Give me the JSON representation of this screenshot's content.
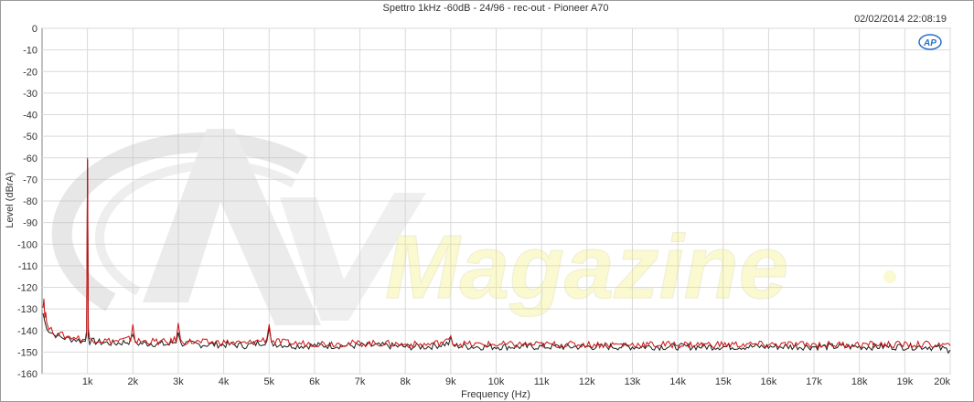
{
  "chart_data": {
    "type": "line",
    "title": "Spettro 1kHz -60dB - 24/96 - rec-out - Pioneer A70",
    "timestamp": "02/02/2014 22:08:19",
    "logo_text": "AP",
    "watermark_text": "Magazine",
    "xlabel": "Frequency (Hz)",
    "ylabel": "Level (dBrA)",
    "xlim": [
      0,
      20000
    ],
    "ylim": [
      -160,
      0
    ],
    "x_ticks": [
      {
        "value": 1000,
        "label": "1k"
      },
      {
        "value": 2000,
        "label": "2k"
      },
      {
        "value": 3000,
        "label": "3k"
      },
      {
        "value": 4000,
        "label": "4k"
      },
      {
        "value": 5000,
        "label": "5k"
      },
      {
        "value": 6000,
        "label": "6k"
      },
      {
        "value": 7000,
        "label": "7k"
      },
      {
        "value": 8000,
        "label": "8k"
      },
      {
        "value": 9000,
        "label": "9k"
      },
      {
        "value": 10000,
        "label": "10k"
      },
      {
        "value": 11000,
        "label": "11k"
      },
      {
        "value": 12000,
        "label": "12k"
      },
      {
        "value": 13000,
        "label": "13k"
      },
      {
        "value": 14000,
        "label": "14k"
      },
      {
        "value": 15000,
        "label": "15k"
      },
      {
        "value": 16000,
        "label": "16k"
      },
      {
        "value": 17000,
        "label": "17k"
      },
      {
        "value": 18000,
        "label": "18k"
      },
      {
        "value": 19000,
        "label": "19k"
      },
      {
        "value": 20000,
        "label": "20k"
      }
    ],
    "y_ticks": [
      {
        "value": 0,
        "label": "0"
      },
      {
        "value": -10,
        "label": "-10"
      },
      {
        "value": -20,
        "label": "-20"
      },
      {
        "value": -30,
        "label": "-30"
      },
      {
        "value": -40,
        "label": "-40"
      },
      {
        "value": -50,
        "label": "-50"
      },
      {
        "value": -60,
        "label": "-60"
      },
      {
        "value": -70,
        "label": "-70"
      },
      {
        "value": -80,
        "label": "-80"
      },
      {
        "value": -90,
        "label": "-90"
      },
      {
        "value": -100,
        "label": "-100"
      },
      {
        "value": -110,
        "label": "-110"
      },
      {
        "value": -120,
        "label": "-120"
      },
      {
        "value": -130,
        "label": "-130"
      },
      {
        "value": -140,
        "label": "-140"
      },
      {
        "value": -150,
        "label": "-150"
      },
      {
        "value": -160,
        "label": "-160"
      }
    ],
    "grid": true,
    "series": [
      {
        "color": "#1a1a1a",
        "x": [
          20,
          60,
          100,
          150,
          200,
          300,
          400,
          500,
          600,
          700,
          800,
          900,
          950,
          980,
          1000,
          1020,
          1050,
          1100,
          1300,
          1600,
          1950,
          2000,
          2050,
          2400,
          2800,
          2950,
          3000,
          3050,
          3500,
          4000,
          4500,
          4950,
          5000,
          5050,
          5500,
          6000,
          6500,
          7000,
          7500,
          8000,
          8500,
          8950,
          9000,
          9050,
          9500,
          10000,
          11000,
          12000,
          13000,
          14000,
          15000,
          16000,
          17000,
          18000,
          19000,
          19500,
          20000
        ],
        "y": [
          -132,
          -136,
          -138,
          -140,
          -141,
          -142,
          -143,
          -143.5,
          -144,
          -144,
          -144.5,
          -145,
          -145,
          -142,
          -61,
          -142,
          -145,
          -145,
          -145.5,
          -146,
          -145,
          -141,
          -146,
          -146,
          -146.5,
          -145,
          -140,
          -146,
          -146.5,
          -146.5,
          -147,
          -145,
          -140,
          -146,
          -147,
          -147,
          -147,
          -147,
          -147,
          -147.5,
          -147.5,
          -146,
          -144,
          -147,
          -147.5,
          -147.5,
          -147.5,
          -147.5,
          -147.5,
          -147.5,
          -147.5,
          -147.5,
          -147.5,
          -147.5,
          -147.5,
          -147.5,
          -149
        ]
      },
      {
        "color": "#cc1111",
        "x": [
          20,
          40,
          60,
          80,
          100,
          150,
          200,
          300,
          400,
          500,
          600,
          700,
          800,
          900,
          950,
          980,
          1000,
          1020,
          1050,
          1100,
          1300,
          1600,
          1950,
          2000,
          2050,
          2400,
          2800,
          2950,
          3000,
          3050,
          3500,
          4000,
          4500,
          4950,
          5000,
          5050,
          5500,
          6000,
          6500,
          7000,
          7500,
          8000,
          8500,
          8950,
          9000,
          9050,
          9500,
          10000,
          11000,
          12000,
          13000,
          14000,
          15000,
          16000,
          17000,
          18000,
          19000,
          19500,
          20000
        ],
        "y": [
          -128,
          -125,
          -134,
          -130,
          -137,
          -139,
          -140,
          -141,
          -142,
          -142.5,
          -143,
          -143,
          -143.5,
          -144,
          -144,
          -140,
          -60,
          -140,
          -144,
          -144,
          -144.5,
          -145,
          -144,
          -137,
          -145,
          -145,
          -145.5,
          -144,
          -137,
          -145,
          -145.5,
          -145.5,
          -146,
          -144,
          -136,
          -145,
          -146,
          -146,
          -146,
          -146,
          -146,
          -146.5,
          -146.5,
          -145,
          -141,
          -146,
          -146.5,
          -146.5,
          -146.5,
          -146.5,
          -146.5,
          -146.5,
          -146.5,
          -146.5,
          -146.5,
          -146.5,
          -146.5,
          -146.5,
          -147
        ]
      }
    ]
  }
}
